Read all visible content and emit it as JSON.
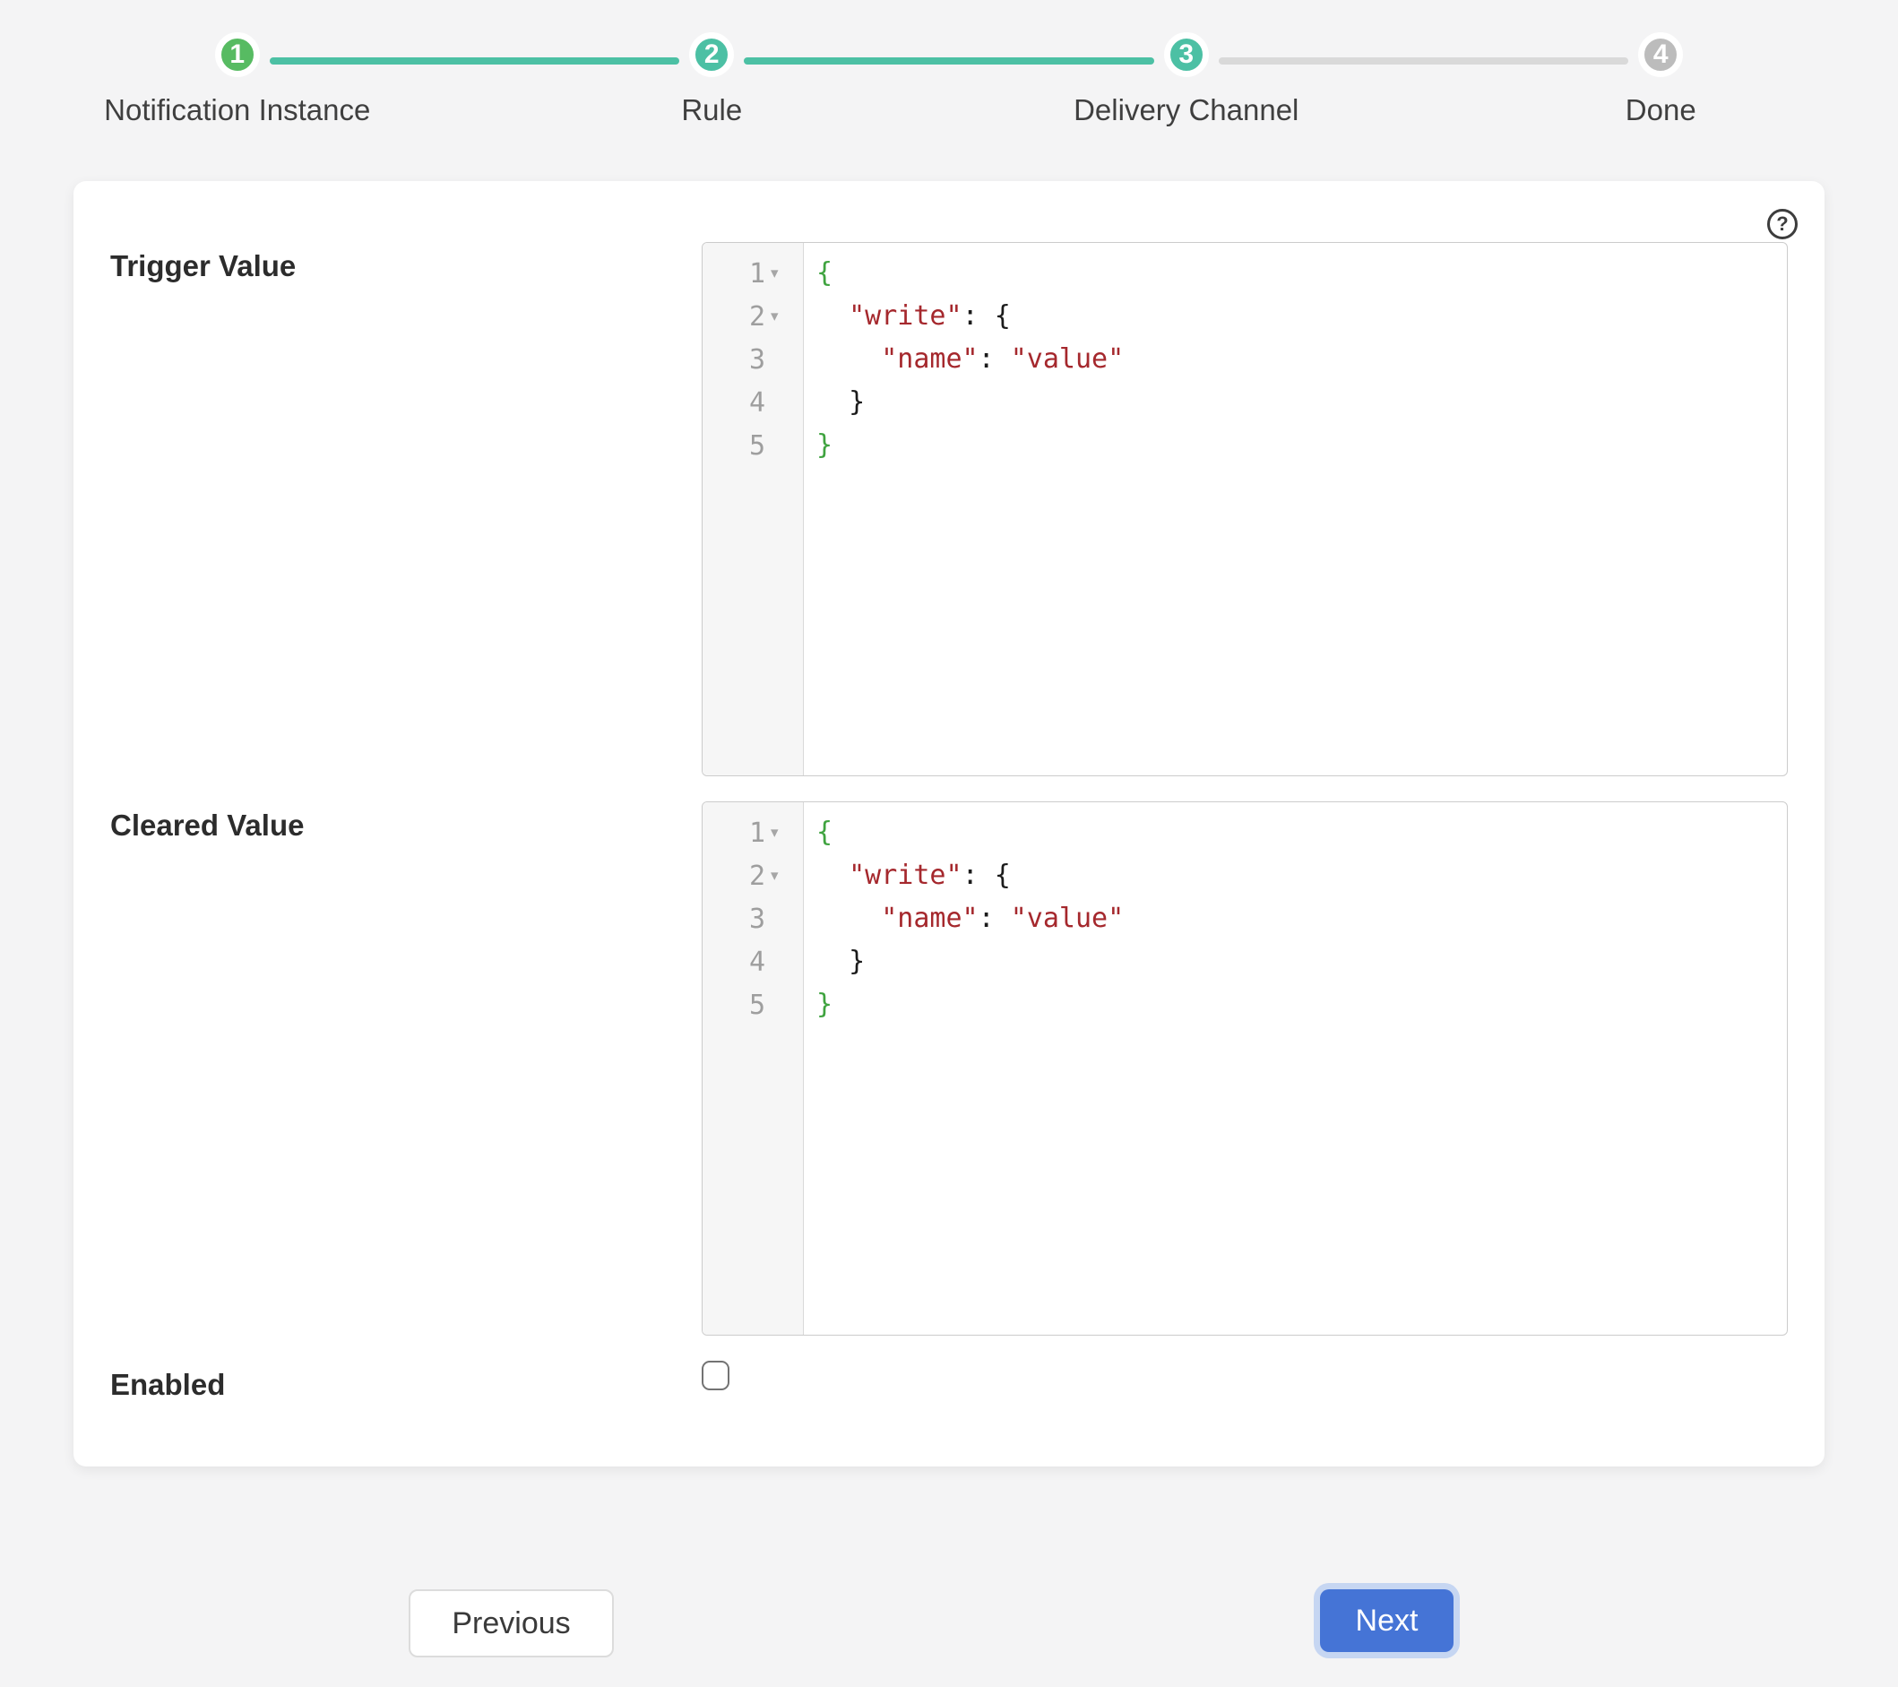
{
  "stepper": {
    "steps": [
      {
        "number": "1",
        "label": "Notification Instance",
        "color": "green"
      },
      {
        "number": "2",
        "label": "Rule",
        "color": "teal"
      },
      {
        "number": "3",
        "label": "Delivery Channel",
        "color": "teal"
      },
      {
        "number": "4",
        "label": "Done",
        "color": "gray"
      }
    ],
    "connectors": [
      "teal",
      "teal",
      "gray"
    ]
  },
  "form": {
    "trigger": {
      "label": "Trigger Value",
      "lines": [
        {
          "num": "1",
          "fold": true,
          "tokens": [
            {
              "text": "{",
              "type": "green"
            }
          ]
        },
        {
          "num": "2",
          "fold": true,
          "tokens": [
            {
              "text": "  ",
              "type": "plain"
            },
            {
              "text": "\"write\"",
              "type": "string"
            },
            {
              "text": ": ",
              "type": "plain"
            },
            {
              "text": "{",
              "type": "plain"
            }
          ]
        },
        {
          "num": "3",
          "fold": false,
          "tokens": [
            {
              "text": "    ",
              "type": "plain"
            },
            {
              "text": "\"name\"",
              "type": "string"
            },
            {
              "text": ": ",
              "type": "plain"
            },
            {
              "text": "\"value\"",
              "type": "string"
            }
          ]
        },
        {
          "num": "4",
          "fold": false,
          "tokens": [
            {
              "text": "  ",
              "type": "plain"
            },
            {
              "text": "}",
              "type": "plain"
            }
          ]
        },
        {
          "num": "5",
          "fold": false,
          "tokens": [
            {
              "text": "}",
              "type": "green"
            }
          ]
        }
      ]
    },
    "cleared": {
      "label": "Cleared Value",
      "lines": [
        {
          "num": "1",
          "fold": true,
          "tokens": [
            {
              "text": "{",
              "type": "green"
            }
          ]
        },
        {
          "num": "2",
          "fold": true,
          "tokens": [
            {
              "text": "  ",
              "type": "plain"
            },
            {
              "text": "\"write\"",
              "type": "string"
            },
            {
              "text": ": ",
              "type": "plain"
            },
            {
              "text": "{",
              "type": "plain"
            }
          ]
        },
        {
          "num": "3",
          "fold": false,
          "tokens": [
            {
              "text": "    ",
              "type": "plain"
            },
            {
              "text": "\"name\"",
              "type": "string"
            },
            {
              "text": ": ",
              "type": "plain"
            },
            {
              "text": "\"value\"",
              "type": "string"
            }
          ]
        },
        {
          "num": "4",
          "fold": false,
          "tokens": [
            {
              "text": "  ",
              "type": "plain"
            },
            {
              "text": "}",
              "type": "plain"
            }
          ]
        },
        {
          "num": "5",
          "fold": false,
          "tokens": [
            {
              "text": "}",
              "type": "green"
            }
          ]
        }
      ]
    },
    "enabled": {
      "label": "Enabled",
      "checked": false
    }
  },
  "footer": {
    "previous_label": "Previous",
    "next_label": "Next"
  },
  "icons": {
    "help": "?",
    "fold": "▾"
  },
  "colors": {
    "step_complete_green": "#57bb62",
    "step_active_teal": "#4cc0a4",
    "step_upcoming_gray": "#bcbcbc",
    "connector_gray": "#d9d9d9",
    "code_bracket_green": "#3fa33f",
    "code_string_red": "#a5282d",
    "code_plain": "#1b1b1b",
    "next_button_blue": "#4574d6",
    "next_button_ring": "#c6d6f2"
  }
}
